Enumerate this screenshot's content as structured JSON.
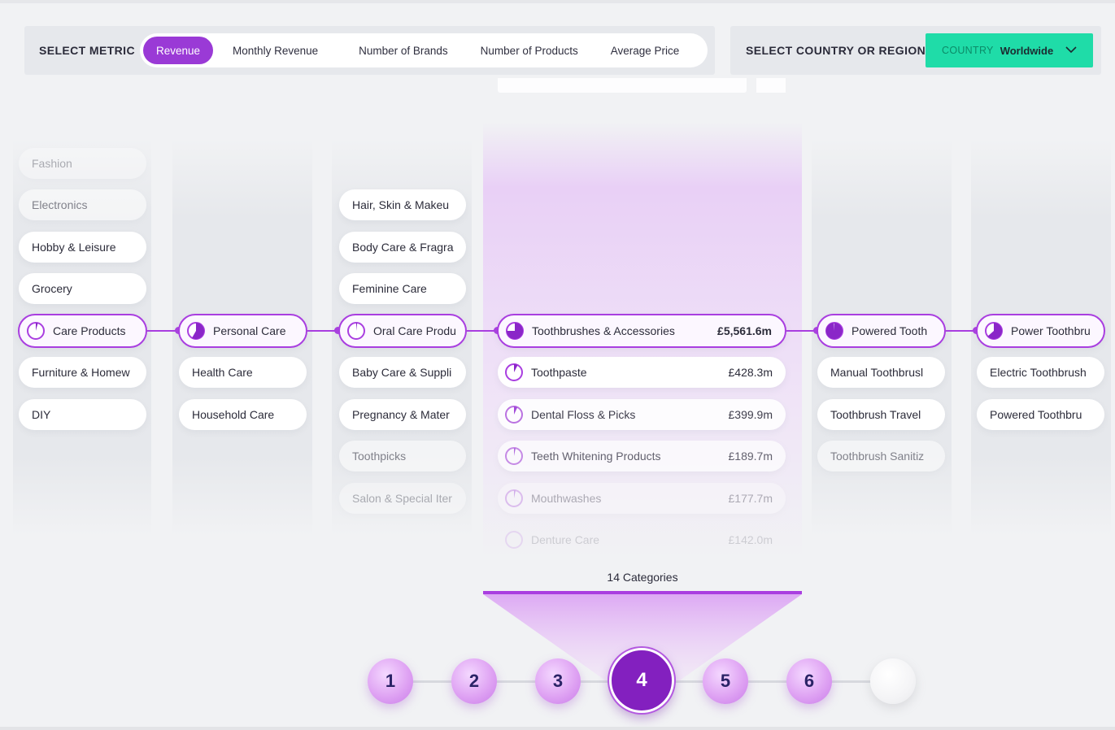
{
  "metric_bar": {
    "title": "SELECT METRIC",
    "options": [
      "Revenue",
      "Monthly Revenue",
      "Number of Brands",
      "Number of Products",
      "Average Price"
    ],
    "active": "Revenue"
  },
  "country_bar": {
    "title": "SELECT COUNTRY OR REGION",
    "label": "COUNTRY",
    "value": "Worldwide",
    "accent": "#1fdca8"
  },
  "accent_color": "#a93ee0",
  "columns": [
    {
      "level": 1,
      "items": [
        {
          "label": "Fashion"
        },
        {
          "label": "Electronics"
        },
        {
          "label": "Hobby & Leisure"
        },
        {
          "label": "Grocery"
        },
        {
          "label": "Care Products",
          "selected": true
        },
        {
          "label": "Furniture & Homew"
        },
        {
          "label": "DIY"
        }
      ]
    },
    {
      "level": 2,
      "items": [
        {
          "label": "Personal Care",
          "selected": true
        },
        {
          "label": "Health Care"
        },
        {
          "label": "Household Care"
        }
      ]
    },
    {
      "level": 3,
      "items": [
        {
          "label": "Hair, Skin & Makeu"
        },
        {
          "label": "Body Care & Fragra"
        },
        {
          "label": "Feminine Care"
        },
        {
          "label": "Oral Care Produ",
          "selected": true
        },
        {
          "label": "Baby Care & Suppli"
        },
        {
          "label": "Pregnancy & Mater"
        },
        {
          "label": "Toothpicks"
        },
        {
          "label": "Salon & Special Iter"
        }
      ]
    },
    {
      "level": 4,
      "items": [
        {
          "label": "Toothbrushes & Accessories",
          "value": "£5,561.6m",
          "selected": true
        },
        {
          "label": "Toothpaste",
          "value": "£428.3m"
        },
        {
          "label": "Dental Floss & Picks",
          "value": "£399.9m"
        },
        {
          "label": "Teeth Whitening Products",
          "value": "£189.7m"
        },
        {
          "label": "Mouthwashes",
          "value": "£177.7m"
        },
        {
          "label": "Denture Care",
          "value": "£142.0m"
        }
      ]
    },
    {
      "level": 5,
      "items": [
        {
          "label": "Powered Tooth",
          "selected": true
        },
        {
          "label": "Manual Toothbrusl"
        },
        {
          "label": "Toothbrush Travel"
        },
        {
          "label": "Toothbrush Sanitiz"
        }
      ]
    },
    {
      "level": 6,
      "items": [
        {
          "label": "Power Toothbru",
          "selected": true
        },
        {
          "label": "Electric Toothbrush"
        },
        {
          "label": "Powered Toothbru"
        }
      ]
    }
  ],
  "footer": {
    "category_count": "14 Categories",
    "steps": [
      "1",
      "2",
      "3",
      "4",
      "5",
      "6",
      ""
    ],
    "active_step": "4"
  }
}
